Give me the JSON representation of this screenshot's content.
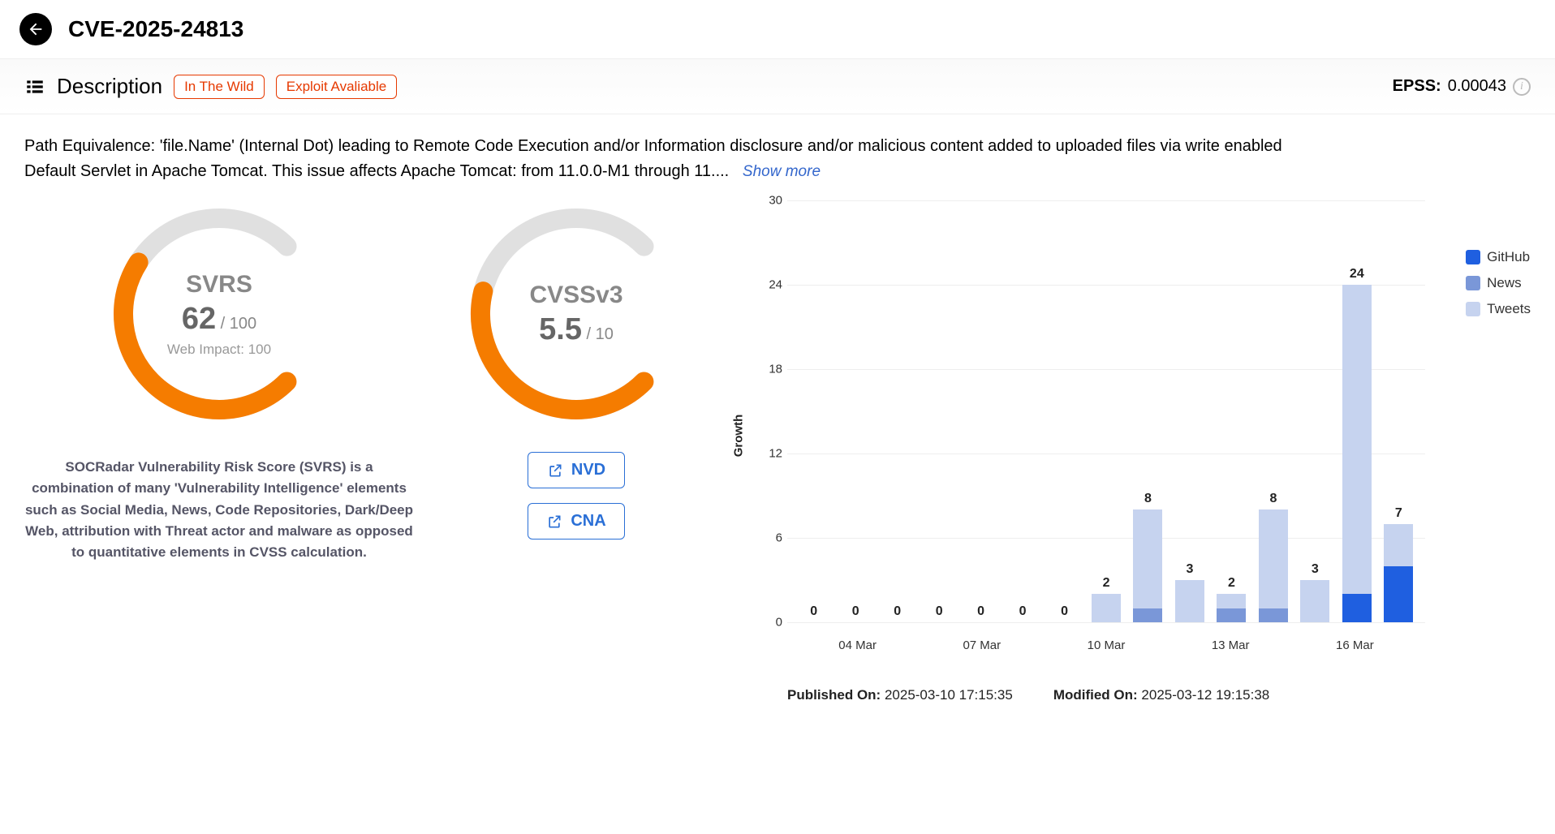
{
  "header": {
    "title": "CVE-2025-24813"
  },
  "section": {
    "title": "Description",
    "badges": [
      "In The Wild",
      "Exploit Avaliable"
    ],
    "epss_label": "EPSS:",
    "epss_value": "0.00043"
  },
  "description": {
    "text": "Path Equivalence: 'file.Name' (Internal Dot) leading to Remote Code Execution and/or Information disclosure and/or malicious content added to uploaded files via write enabled Default Servlet in Apache Tomcat. This issue affects Apache Tomcat: from 11.0.0-M1 through 11....",
    "show_more": "Show more"
  },
  "svrs": {
    "name": "SVRS",
    "value": "62",
    "denom": " / 100",
    "sub": "Web Impact: 100",
    "desc": "SOCRadar Vulnerability Risk Score (SVRS) is a combination of many 'Vulnerability Intelligence' elements such as Social Media, News, Code Repositories, Dark/Deep Web, attribution with Threat actor and malware as opposed to quantitative elements in CVSS calculation."
  },
  "cvss": {
    "name": "CVSSv3",
    "value": "5.5",
    "denom": " / 10",
    "links": {
      "nvd": "NVD",
      "cna": "CNA"
    }
  },
  "chart_data": {
    "type": "bar",
    "title": "",
    "xlabel": "",
    "ylabel": "Growth",
    "ylim": [
      0,
      30
    ],
    "yticks": [
      0,
      6,
      12,
      18,
      24,
      30
    ],
    "categories": [
      "03 Mar",
      "04 Mar",
      "05 Mar",
      "06 Mar",
      "07 Mar",
      "08 Mar",
      "09 Mar",
      "10 Mar",
      "11 Mar",
      "12 Mar",
      "13 Mar",
      "14 Mar",
      "15 Mar",
      "16 Mar",
      "17 Mar"
    ],
    "x_tick_labels": [
      "",
      "04 Mar",
      "",
      "",
      "07 Mar",
      "",
      "",
      "10 Mar",
      "",
      "",
      "13 Mar",
      "",
      "",
      "16 Mar",
      ""
    ],
    "series": [
      {
        "name": "GitHub",
        "color": "#1f5fe0",
        "values": [
          0,
          0,
          0,
          0,
          0,
          0,
          0,
          0,
          0,
          0,
          0,
          0,
          0,
          2,
          4
        ]
      },
      {
        "name": "News",
        "color": "#7a97d8",
        "values": [
          0,
          0,
          0,
          0,
          0,
          0,
          0,
          0,
          1,
          0,
          1,
          1,
          0,
          0,
          0
        ]
      },
      {
        "name": "Tweets",
        "color": "#c6d3ef",
        "values": [
          0,
          0,
          0,
          0,
          0,
          0,
          0,
          2,
          7,
          3,
          1,
          7,
          3,
          22,
          3
        ]
      }
    ],
    "totals": [
      0,
      0,
      0,
      0,
      0,
      0,
      0,
      2,
      8,
      3,
      2,
      8,
      3,
      24,
      7
    ]
  },
  "legend": [
    {
      "label": "GitHub",
      "color": "#1f5fe0"
    },
    {
      "label": "News",
      "color": "#7a97d8"
    },
    {
      "label": "Tweets",
      "color": "#c6d3ef"
    }
  ],
  "dates": {
    "published_label": "Published On: ",
    "published_value": "2025-03-10 17:15:35",
    "modified_label": "Modified On: ",
    "modified_value": "2025-03-12 19:15:38"
  }
}
